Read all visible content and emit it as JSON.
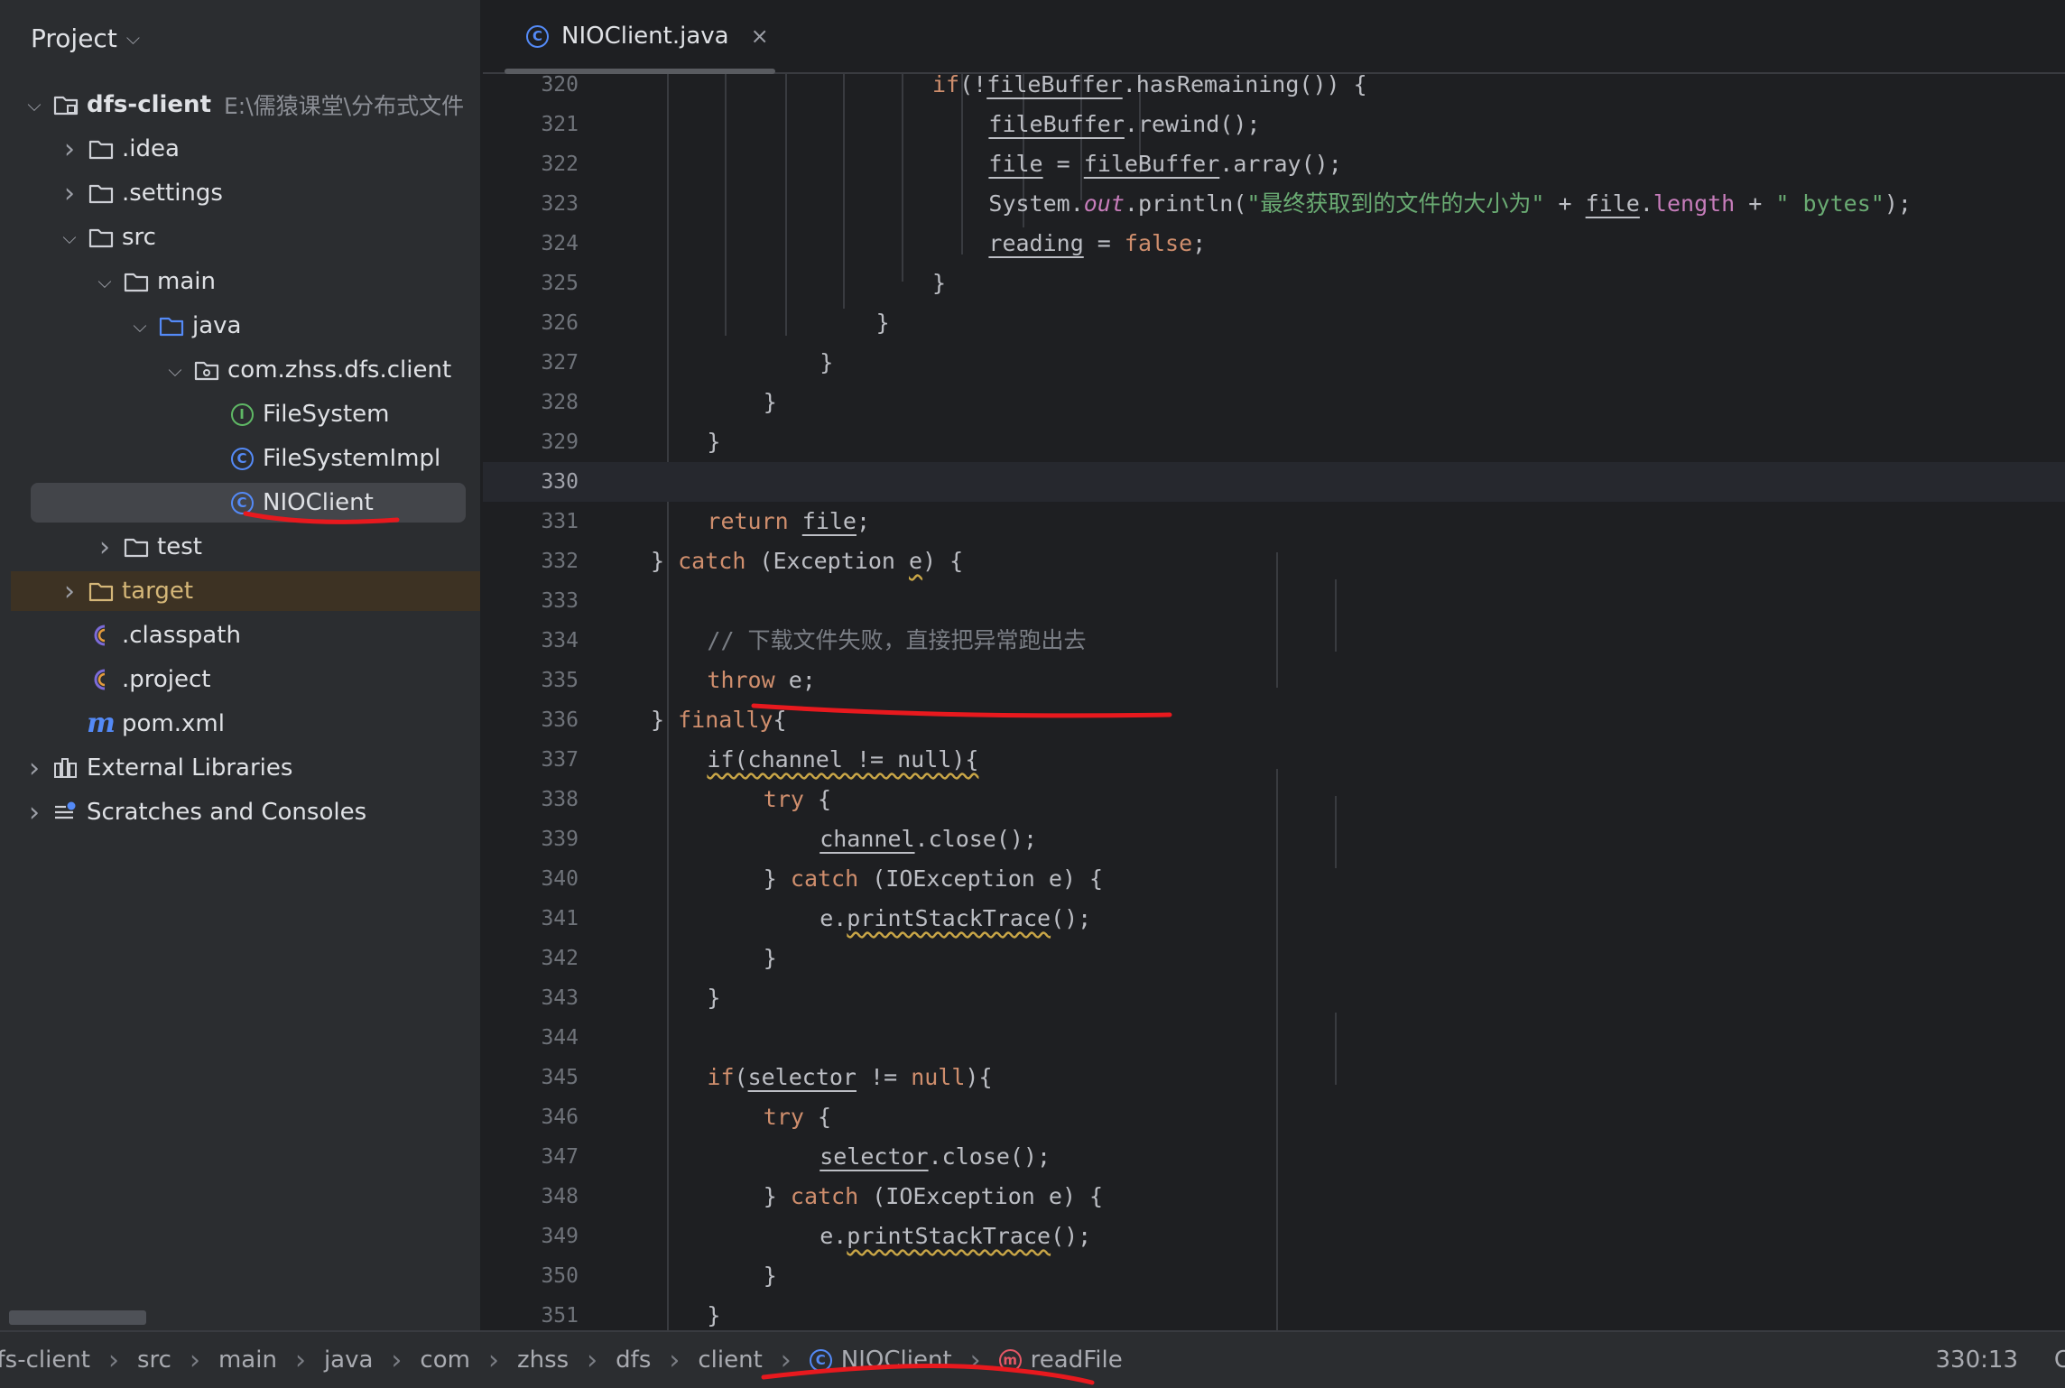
{
  "project_panel": {
    "title": "Project",
    "tree": [
      {
        "label": "dfs-client",
        "path": "E:\\儒猿课堂\\分布式文件",
        "depth": 0,
        "arrow": "open",
        "icon": "module-folder-icon",
        "bold": true
      },
      {
        "label": ".idea",
        "depth": 1,
        "arrow": "closed",
        "icon": "folder-icon"
      },
      {
        "label": ".settings",
        "depth": 1,
        "arrow": "closed",
        "icon": "folder-icon"
      },
      {
        "label": "src",
        "depth": 1,
        "arrow": "open",
        "icon": "folder-icon"
      },
      {
        "label": "main",
        "depth": 2,
        "arrow": "open",
        "icon": "folder-icon"
      },
      {
        "label": "java",
        "depth": 3,
        "arrow": "open",
        "icon": "source-folder-icon"
      },
      {
        "label": "com.zhss.dfs.client",
        "depth": 4,
        "arrow": "open",
        "icon": "package-icon"
      },
      {
        "label": "FileSystem",
        "depth": 5,
        "arrow": "none",
        "icon": "interface-icon"
      },
      {
        "label": "FileSystemImpl",
        "depth": 5,
        "arrow": "none",
        "icon": "class-icon"
      },
      {
        "label": "NIOClient",
        "depth": 5,
        "arrow": "none",
        "icon": "class-icon",
        "selected": true
      },
      {
        "label": "test",
        "depth": 2,
        "arrow": "closed",
        "icon": "folder-icon"
      },
      {
        "label": "target",
        "depth": 1,
        "arrow": "closed",
        "icon": "excluded-folder-icon",
        "excluded": true
      },
      {
        "label": ".classpath",
        "depth": 1,
        "arrow": "none",
        "icon": "eclipse-file-icon"
      },
      {
        "label": ".project",
        "depth": 1,
        "arrow": "none",
        "icon": "eclipse-file-icon"
      },
      {
        "label": "pom.xml",
        "depth": 1,
        "arrow": "none",
        "icon": "maven-icon"
      },
      {
        "label": "External Libraries",
        "depth": 0,
        "arrow": "closed",
        "icon": "library-icon"
      },
      {
        "label": "Scratches and Consoles",
        "depth": 0,
        "arrow": "closed",
        "icon": "scratches-icon"
      }
    ]
  },
  "tab": {
    "label": "NIOClient.java",
    "icon": "class-icon",
    "close": "×"
  },
  "editor": {
    "current_line": 330,
    "lines": [
      {
        "n": 320,
        "indent": 5,
        "tokens": [
          [
            "kw",
            "if"
          ],
          [
            "",
            "(!"
          ],
          [
            "u",
            "fileBuffer"
          ],
          [
            "",
            ".hasRemaining()) {"
          ]
        ]
      },
      {
        "n": 321,
        "indent": 6,
        "tokens": [
          [
            "u",
            "fileBuffer"
          ],
          [
            "",
            ".rewind();"
          ]
        ]
      },
      {
        "n": 322,
        "indent": 6,
        "tokens": [
          [
            "u",
            "file"
          ],
          [
            "",
            " = "
          ],
          [
            "u",
            "fileBuffer"
          ],
          [
            "",
            ".array();"
          ]
        ]
      },
      {
        "n": 323,
        "indent": 6,
        "tokens": [
          [
            "",
            "System."
          ],
          [
            "sfld",
            "out"
          ],
          [
            "",
            ".println("
          ],
          [
            "str",
            "\"最终获取到的文件的大小为\""
          ],
          [
            "",
            " + "
          ],
          [
            "u",
            "file"
          ],
          [
            "",
            "."
          ],
          [
            "fld",
            "length"
          ],
          [
            "",
            " + "
          ],
          [
            "str",
            "\" bytes\""
          ],
          [
            "",
            ");"
          ]
        ]
      },
      {
        "n": 324,
        "indent": 6,
        "tokens": [
          [
            "u",
            "reading"
          ],
          [
            "",
            " = "
          ],
          [
            "kw",
            "false"
          ],
          [
            "",
            ";"
          ]
        ]
      },
      {
        "n": 325,
        "indent": 5,
        "tokens": [
          [
            "",
            "}"
          ]
        ]
      },
      {
        "n": 326,
        "indent": 4,
        "tokens": [
          [
            "",
            "}"
          ]
        ]
      },
      {
        "n": 327,
        "indent": 3,
        "tokens": [
          [
            "",
            "}"
          ]
        ]
      },
      {
        "n": 328,
        "indent": 2,
        "tokens": [
          [
            "",
            "}"
          ]
        ]
      },
      {
        "n": 329,
        "indent": 1,
        "tokens": [
          [
            "",
            "}"
          ]
        ]
      },
      {
        "n": 330,
        "indent": 0,
        "tokens": []
      },
      {
        "n": 331,
        "indent": 1,
        "tokens": [
          [
            "kw",
            "return"
          ],
          [
            "",
            " "
          ],
          [
            "u",
            "file"
          ],
          [
            "",
            ";"
          ]
        ]
      },
      {
        "n": 332,
        "indent": 0,
        "tokens": [
          [
            "",
            "} "
          ],
          [
            "kw",
            "catch"
          ],
          [
            "",
            " (Exception "
          ],
          [
            "wav",
            "e"
          ],
          [
            "",
            ") {"
          ]
        ]
      },
      {
        "n": 333,
        "indent": 0,
        "tokens": []
      },
      {
        "n": 334,
        "indent": 1,
        "tokens": [
          [
            "cmt",
            "// 下载文件失败，直接把异常跑出去"
          ]
        ]
      },
      {
        "n": 335,
        "indent": 1,
        "tokens": [
          [
            "kw",
            "throw"
          ],
          [
            "",
            " e;"
          ]
        ]
      },
      {
        "n": 336,
        "indent": 0,
        "tokens": [
          [
            "",
            "} "
          ],
          [
            "kw",
            "finally"
          ],
          [
            "",
            "{"
          ]
        ]
      },
      {
        "n": 337,
        "indent": 1,
        "tokens": [
          [
            "wav",
            "if(channel != null){"
          ]
        ]
      },
      {
        "n": 338,
        "indent": 2,
        "tokens": [
          [
            "kw",
            "try"
          ],
          [
            "",
            " {"
          ]
        ]
      },
      {
        "n": 339,
        "indent": 3,
        "tokens": [
          [
            "u",
            "channel"
          ],
          [
            "",
            ".close();"
          ]
        ]
      },
      {
        "n": 340,
        "indent": 2,
        "tokens": [
          [
            "",
            "} "
          ],
          [
            "kw",
            "catch"
          ],
          [
            "",
            " (IOException e) {"
          ]
        ]
      },
      {
        "n": 341,
        "indent": 3,
        "tokens": [
          [
            "",
            "e."
          ],
          [
            "wav",
            "printStackTrace"
          ],
          [
            "",
            "();"
          ]
        ]
      },
      {
        "n": 342,
        "indent": 2,
        "tokens": [
          [
            "",
            "}"
          ]
        ]
      },
      {
        "n": 343,
        "indent": 1,
        "tokens": [
          [
            "",
            "}"
          ]
        ]
      },
      {
        "n": 344,
        "indent": 0,
        "tokens": []
      },
      {
        "n": 345,
        "indent": 1,
        "tokens": [
          [
            "kw",
            "if"
          ],
          [
            "",
            "("
          ],
          [
            "u",
            "selector"
          ],
          [
            "",
            " != "
          ],
          [
            "kw",
            "null"
          ],
          [
            "",
            "){"
          ]
        ]
      },
      {
        "n": 346,
        "indent": 2,
        "tokens": [
          [
            "kw",
            "try"
          ],
          [
            "",
            " {"
          ]
        ]
      },
      {
        "n": 347,
        "indent": 3,
        "tokens": [
          [
            "u",
            "selector"
          ],
          [
            "",
            ".close();"
          ]
        ]
      },
      {
        "n": 348,
        "indent": 2,
        "tokens": [
          [
            "",
            "} "
          ],
          [
            "kw",
            "catch"
          ],
          [
            "",
            " (IOException e) {"
          ]
        ]
      },
      {
        "n": 349,
        "indent": 3,
        "tokens": [
          [
            "",
            "e."
          ],
          [
            "wav",
            "printStackTrace"
          ],
          [
            "",
            "();"
          ]
        ]
      },
      {
        "n": 350,
        "indent": 2,
        "tokens": [
          [
            "",
            "}"
          ]
        ]
      },
      {
        "n": 351,
        "indent": 1,
        "tokens": [
          [
            "",
            "}"
          ]
        ]
      }
    ]
  },
  "status_bar": {
    "breadcrumb": [
      {
        "label": "dfs-client"
      },
      {
        "label": "src"
      },
      {
        "label": "main"
      },
      {
        "label": "java"
      },
      {
        "label": "com"
      },
      {
        "label": "zhss"
      },
      {
        "label": "dfs"
      },
      {
        "label": "client"
      },
      {
        "label": "NIOClient",
        "icon": "class-icon"
      },
      {
        "label": "readFile",
        "icon": "method-icon"
      }
    ],
    "cursor_position": "330:13",
    "trailing": "C"
  },
  "colors": {
    "background": "#1e1f22",
    "panel": "#2b2d30",
    "keyword": "#cf8e6d",
    "string": "#6aab73",
    "field": "#c77dbb",
    "class_icon": "#548af7",
    "annotation_red": "#e8191e"
  }
}
